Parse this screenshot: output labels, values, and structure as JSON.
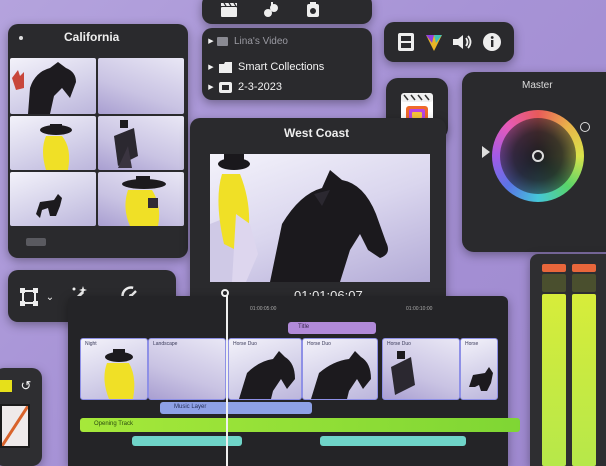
{
  "browser": {
    "title": "California",
    "footer_left": "",
    "footer_mid": "",
    "footer_right": ""
  },
  "library": {
    "event": "Lina's Video",
    "items": [
      "Smart Collections",
      "2-3-2023"
    ]
  },
  "viewer": {
    "title": "West Coast",
    "timecode": "01:01:06:07"
  },
  "color": {
    "title": "Master"
  },
  "timeline": {
    "ruler_left": "01:00:05:00",
    "ruler_right": "01:00:10:00",
    "title_clip": "Title",
    "clips": [
      {
        "label": "Night"
      },
      {
        "label": "Landscape"
      },
      {
        "label": "Horse Duo"
      },
      {
        "label": "Horse Duo"
      },
      {
        "label": "Horse Duo"
      },
      {
        "label": "Horse"
      }
    ],
    "connected_audio": "Music Layer",
    "music_track": "Opening Track",
    "sfx_left": "",
    "sfx_right": ""
  },
  "colors": {
    "panel": "#2a2a2d",
    "accent_yellow": "#e6e01a",
    "meter_green": "#b6e84a",
    "meter_red": "#e8663b",
    "clip_purple": "#b18ad9",
    "clip_blue": "#8ea1e6",
    "audio_green": "#8ede3a",
    "sfx_teal": "#6fd4c8"
  }
}
